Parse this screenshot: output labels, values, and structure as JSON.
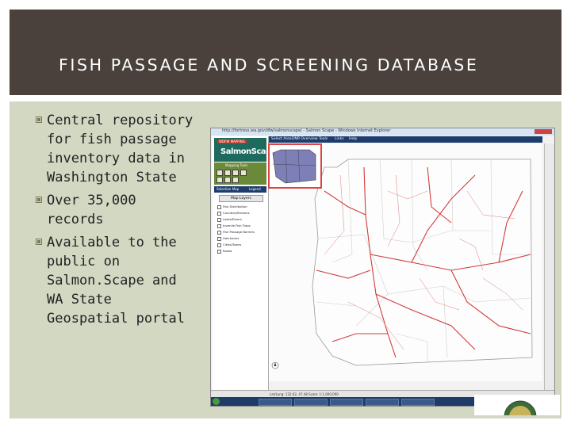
{
  "slide": {
    "title": "FISH PASSAGE AND SCREENING DATABASE",
    "bullets": [
      "Central repository for fish passage inventory data in Washington State",
      "Over 35,000 records",
      "Available to the public on Salmon.Scape and WA State Geospatial portal"
    ]
  },
  "colors": {
    "title_bar": "#4a413c",
    "content_bg": "#d2d8c2",
    "bullet_icon": "#7a7a5a",
    "app_header": "#1d6b5e",
    "road_lines": "#d23b3b",
    "county_lines": "#c8c8c8",
    "taskbar": "#1f3b68"
  },
  "screenshot": {
    "window_title": "http://fortress.wa.gov/dfw/salmonscape/ - Salmon Scape - Windows Internet Explorer",
    "app_badge": "WDFW MAPPING",
    "app_name": "SalmonScape",
    "nav_items": [
      "Select Area",
      "DNR Overview",
      "Tools",
      "Links",
      "Help"
    ],
    "mapping_tools_label": "Mapping Tools",
    "tab_left": "Selection Map",
    "tab_right": "Legend",
    "map_layers_header": "Map Layers",
    "layers": [
      "Fish Distribution",
      "Counties/Streams",
      "Lakes/Rivers",
      "Juvenile Fish Traps",
      "Fish Passage Barriers",
      "Hatcheries",
      "Cities/Towns",
      "Roads"
    ],
    "status_text": "Lat/Long: 122.02, 47.48   Scale: 1:1,000,000"
  }
}
